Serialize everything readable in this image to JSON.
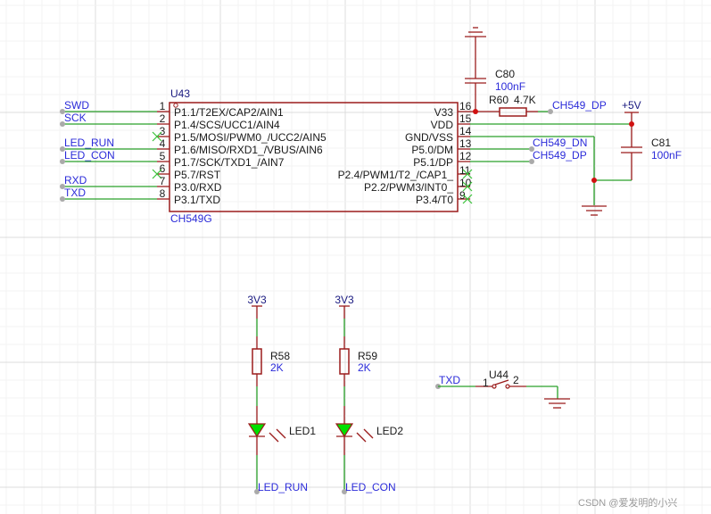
{
  "chip": {
    "designator": "U43",
    "part": "CH549G",
    "left_pins": [
      {
        "num": "1",
        "name": "P1.1/T2EX/CAP2/AIN1",
        "net": "SWD"
      },
      {
        "num": "2",
        "name": "P1.4/SCS/UCC1/AIN4",
        "net": "SCK"
      },
      {
        "num": "3",
        "name": "P1.5/MOSI/PWM0_/UCC2/AIN5",
        "net": ""
      },
      {
        "num": "4",
        "name": "P1.6/MISO/RXD1_/VBUS/AIN6",
        "net": "LED_RUN"
      },
      {
        "num": "5",
        "name": "P1.7/SCK/TXD1_/AIN7",
        "net": "LED_CON"
      },
      {
        "num": "6",
        "name": "P5.7/RST",
        "net": ""
      },
      {
        "num": "7",
        "name": "P3.0/RXD",
        "net": "RXD"
      },
      {
        "num": "8",
        "name": "P3.1/TXD",
        "net": "TXD"
      }
    ],
    "right_pins": [
      {
        "num": "16",
        "name": "V33"
      },
      {
        "num": "15",
        "name": "VDD"
      },
      {
        "num": "14",
        "name": "GND/VSS"
      },
      {
        "num": "13",
        "name": "P5.0/DM",
        "net": "CH549_DN"
      },
      {
        "num": "12",
        "name": "P5.1/DP",
        "net": "CH549_DP"
      },
      {
        "num": "11",
        "name": "P2.4/PWM1/T2_/CAP1_"
      },
      {
        "num": "10",
        "name": "P2.2/PWM3/INT0_"
      },
      {
        "num": "9",
        "name": "P3.4/T0"
      }
    ]
  },
  "parts": {
    "c80": {
      "ref": "C80",
      "value": "100nF"
    },
    "r60": {
      "ref": "R60",
      "value": "4.7K",
      "net": "CH549_DP"
    },
    "c81": {
      "ref": "C81",
      "value": "100nF"
    },
    "vcc5": "+5V",
    "r58": {
      "ref": "R58",
      "value": "2K",
      "power": "3V3",
      "net": "LED_RUN"
    },
    "r59": {
      "ref": "R59",
      "value": "2K",
      "power": "3V3",
      "net": "LED_CON"
    },
    "led1": "LED1",
    "led2": "LED2",
    "u44": {
      "ref": "U44",
      "pin1": "1",
      "pin2": "2",
      "net": "TXD"
    }
  },
  "watermark": "CSDN @爱发明的小兴",
  "colors": {
    "wire": "#2aa02a",
    "component": "#9b1c1c",
    "net_label": "#2b2bd9",
    "junction": "#d01010",
    "led_fill": "#00e000"
  }
}
